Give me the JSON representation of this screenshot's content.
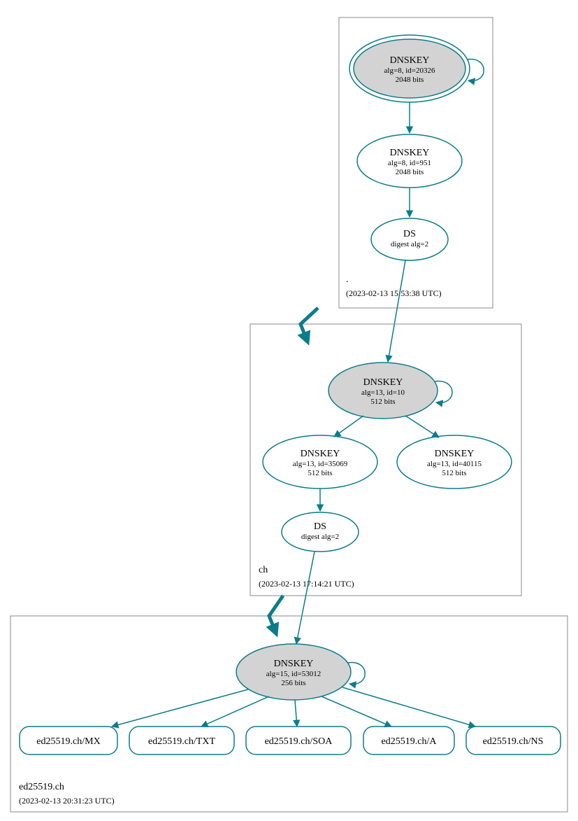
{
  "colors": {
    "stroke": "#0a7c8c",
    "ksk_fill": "#d3d3d3",
    "box_stroke": "#888888"
  },
  "zones": {
    "root": {
      "name": ".",
      "timestamp": "(2023-02-13 15:53:38 UTC)",
      "ksk": {
        "title": "DNSKEY",
        "line2": "alg=8, id=20326",
        "line3": "2048 bits"
      },
      "zsk": {
        "title": "DNSKEY",
        "line2": "alg=8, id=951",
        "line3": "2048 bits"
      },
      "ds": {
        "title": "DS",
        "line2": "digest alg=2"
      }
    },
    "ch": {
      "name": "ch",
      "timestamp": "(2023-02-13 17:14:21 UTC)",
      "ksk": {
        "title": "DNSKEY",
        "line2": "alg=13, id=10",
        "line3": "512 bits"
      },
      "zsk1": {
        "title": "DNSKEY",
        "line2": "alg=13, id=35069",
        "line3": "512 bits"
      },
      "zsk2": {
        "title": "DNSKEY",
        "line2": "alg=13, id=40115",
        "line3": "512 bits"
      },
      "ds": {
        "title": "DS",
        "line2": "digest alg=2"
      }
    },
    "leaf": {
      "name": "ed25519.ch",
      "timestamp": "(2023-02-13 20:31:23 UTC)",
      "ksk": {
        "title": "DNSKEY",
        "line2": "alg=15, id=53012",
        "line3": "256 bits"
      },
      "rrsets": {
        "mx": "ed25519.ch/MX",
        "txt": "ed25519.ch/TXT",
        "soa": "ed25519.ch/SOA",
        "a": "ed25519.ch/A",
        "ns": "ed25519.ch/NS"
      }
    }
  }
}
